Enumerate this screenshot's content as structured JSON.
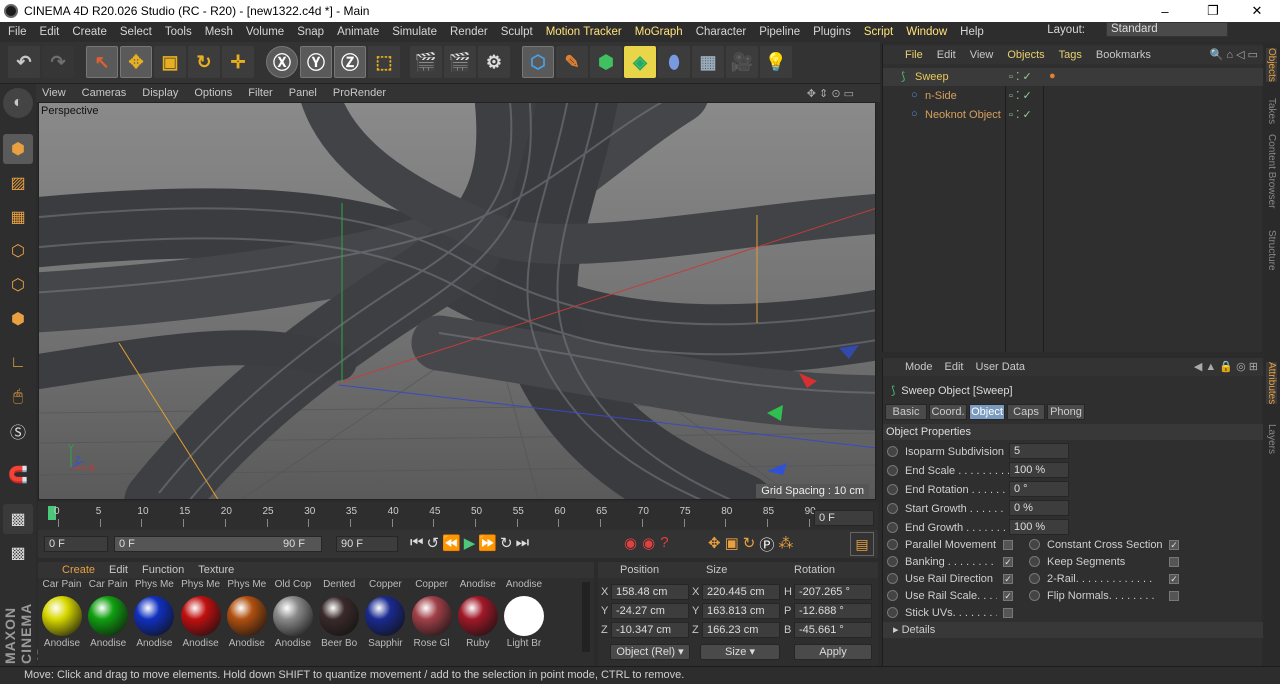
{
  "window": {
    "title": "CINEMA 4D R20.026 Studio (RC - R20) - [new1322.c4d *] - Main",
    "minimize": "–",
    "maximize": "❐",
    "close": "✕"
  },
  "menu": [
    "File",
    "Edit",
    "Create",
    "Select",
    "Tools",
    "Mesh",
    "Volume",
    "Snap",
    "Animate",
    "Simulate",
    "Render",
    "Sculpt",
    "Motion Tracker",
    "MoGraph",
    "Character",
    "Pipeline",
    "Plugins",
    "Script",
    "Window",
    "Help"
  ],
  "layout": {
    "label": "Layout:",
    "value": "Standard"
  },
  "viewport": {
    "menu": [
      "View",
      "Cameras",
      "Display",
      "Options",
      "Filter",
      "Panel",
      "ProRender"
    ],
    "label": "Perspective",
    "grid_spacing": "Grid Spacing : 10 cm",
    "axes": {
      "x": "X",
      "y": "Y",
      "z": "Z"
    }
  },
  "timeline": {
    "ticks": [
      "0",
      "5",
      "10",
      "15",
      "20",
      "25",
      "30",
      "35",
      "40",
      "45",
      "50",
      "55",
      "60",
      "65",
      "70",
      "75",
      "80",
      "85",
      "90"
    ],
    "current_frame": "0 F",
    "start": "0 F",
    "slider_start": "0 F",
    "slider_end": "90 F",
    "end": "90 F"
  },
  "materials": {
    "menu": [
      "Create",
      "Edit",
      "Function",
      "Texture"
    ],
    "top_labels": [
      "Car Pain",
      "Car Pain",
      "Phys Me",
      "Phys Me",
      "Phys Me",
      "Old Cop",
      "Dented",
      "Copper",
      "Copper",
      "Anodise",
      "Anodise"
    ],
    "items": [
      {
        "name": "Anodise",
        "color": "#d8d800"
      },
      {
        "name": "Anodise",
        "color": "#10a010"
      },
      {
        "name": "Anodise",
        "color": "#1030c0"
      },
      {
        "name": "Anodise",
        "color": "#c01010"
      },
      {
        "name": "Anodise",
        "color": "#b05010"
      },
      {
        "name": "Anodise",
        "color": "#8a8a8a"
      },
      {
        "name": "Beer Bo",
        "color": "#3a2a2a"
      },
      {
        "name": "Sapphir",
        "color": "#1a2a90"
      },
      {
        "name": "Rose Gl",
        "color": "#a04048"
      },
      {
        "name": "Ruby",
        "color": "#a01828"
      },
      {
        "name": "Light Br",
        "color": "#ffffff"
      }
    ]
  },
  "coords": {
    "headers": {
      "position": "Position",
      "size": "Size",
      "rotation": "Rotation"
    },
    "rows": [
      {
        "axis": "X",
        "pos": "158.48 cm",
        "size_axis": "X",
        "size": "220.445 cm",
        "rot_axis": "H",
        "rot": "-207.265 °"
      },
      {
        "axis": "Y",
        "pos": "-24.27 cm",
        "size_axis": "Y",
        "size": "163.813 cm",
        "rot_axis": "P",
        "rot": "-12.688 °"
      },
      {
        "axis": "Z",
        "pos": "-10.347 cm",
        "size_axis": "Z",
        "size": "166.23 cm",
        "rot_axis": "B",
        "rot": "-45.661 °"
      }
    ],
    "mode": "Object (Rel)",
    "size_mode": "Size",
    "apply": "Apply"
  },
  "objects": {
    "menu": [
      "File",
      "Edit",
      "View",
      "Objects",
      "Tags",
      "Bookmarks"
    ],
    "items": [
      {
        "name": "Sweep",
        "color": "#e8c85a"
      },
      {
        "name": "n-Side",
        "color": "#d6a060"
      },
      {
        "name": "Neoknot Object",
        "color": "#d6a060"
      }
    ]
  },
  "attributes": {
    "menu": [
      "Mode",
      "Edit",
      "User Data"
    ],
    "title": "Sweep Object [Sweep]",
    "tabs": [
      "Basic",
      "Coord.",
      "Object",
      "Caps",
      "Phong"
    ],
    "active_tab": "Object",
    "section": "Object Properties",
    "fields": [
      {
        "label": "Isoparm Subdivision",
        "value": "5"
      },
      {
        "label": "End Scale . . . . . . . . .",
        "value": "100 %"
      },
      {
        "label": "End Rotation . . . . . .",
        "value": "0 °"
      },
      {
        "label": "Start Growth . . . . . .",
        "value": "0 %"
      },
      {
        "label": "End Growth . . . . . . .",
        "value": "100 %"
      }
    ],
    "left_checks": [
      {
        "label": "Parallel Movement",
        "checked": "",
        "value": false
      },
      {
        "label": "Banking . . . . . . . .",
        "checked": "✓",
        "value": true
      },
      {
        "label": "Use Rail Direction",
        "checked": "✓",
        "value": true
      },
      {
        "label": "Use Rail Scale. . . .",
        "checked": "✓",
        "value": true
      },
      {
        "label": "Stick UVs. . . . . . . .",
        "checked": "",
        "value": false
      }
    ],
    "right_checks": [
      {
        "label": "Constant Cross Section",
        "checked": "✓",
        "value": true
      },
      {
        "label": "Keep Segments",
        "checked": "",
        "value": false
      },
      {
        "label": "2-Rail. . . . . . . . . . . . .",
        "checked": "✓",
        "value": true
      },
      {
        "label": "Flip Normals. . . . . . . .",
        "checked": "",
        "value": false
      }
    ],
    "details": "▸ Details"
  },
  "side_tabs": [
    "Objects",
    "Takes",
    "Content Browser",
    "Structure",
    "Attributes",
    "Layers"
  ],
  "status": "Move: Click and drag to move elements. Hold down SHIFT to quantize movement / add to the selection in point mode, CTRL to remove.",
  "brand": "MAXON CINEMA 4D"
}
